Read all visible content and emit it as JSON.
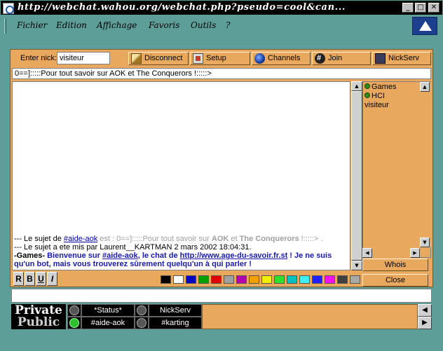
{
  "window": {
    "title": "http://webchat.wahou.org/webchat.php?pseudo=cool&can...",
    "minimize": "_",
    "maximize": "□",
    "close": "✕"
  },
  "menu": [
    {
      "label": "Fichier"
    },
    {
      "label": "Edition"
    },
    {
      "label": "Affichage"
    },
    {
      "label": "Favoris"
    },
    {
      "label": "Outils"
    },
    {
      "label": "?"
    }
  ],
  "toolbar": {
    "nick_label": "Enter nick:",
    "nick_value": "visiteur",
    "disconnect": "Disconnect",
    "setup": "Setup",
    "channels": "Channels",
    "join": "Join",
    "nickserv": "NickServ"
  },
  "topic": "0==]:::::Pour tout savoir sur AOK et The Conquerors !:::::>",
  "chat": {
    "line1_prefix": "--- Le sujet de ",
    "line1_channel": "#aide-aok",
    "line1_mid": " est : 0==]:::::Pour tout savoir sur ",
    "line1_aok": "AOK",
    "line1_and": " et ",
    "line1_tc": "The Conquerors",
    "line1_end": " !:::::> .",
    "line2": "--- Le sujet a ete mis par Laurent__KARTMAN  2 mars 2002 18:04:31.",
    "line3_nick": "-Games-",
    "line3_text1": " Bienvenue sur ",
    "line3_channel": "#aide-aok",
    "line3_text2": ", le chat de ",
    "line3_url": "http://www.age-du-savoir.fr.st",
    "line3_text3": " ! Je ne suis qu'un bot, mais vous trouverez sûrement quelqu'un à qui parler !"
  },
  "users": [
    {
      "name": "Games",
      "op": true
    },
    {
      "name": "HCI",
      "op": true
    },
    {
      "name": "visiteur",
      "op": false
    }
  ],
  "side_buttons": {
    "whois": "Whois",
    "close": "Close"
  },
  "format_buttons": [
    "R",
    "B",
    "U",
    "I"
  ],
  "colors": [
    "#000000",
    "#ffffff",
    "#0000c0",
    "#00a000",
    "#e00000",
    "#a0a0a0",
    "#b000b0",
    "#f0a000",
    "#f0f000",
    "#30e030",
    "#00c0c0",
    "#40f0f0",
    "#2020ff",
    "#f010f0",
    "#404040",
    "#a8a8a8"
  ],
  "brand": {
    "private": "Private",
    "public": "Public"
  },
  "tabs": {
    "status": "*Status*",
    "nickserv": "NickServ",
    "aide_aok": "#aide-aok",
    "karting": "#karting"
  },
  "nav": {
    "left": "◀",
    "right": "▶"
  }
}
